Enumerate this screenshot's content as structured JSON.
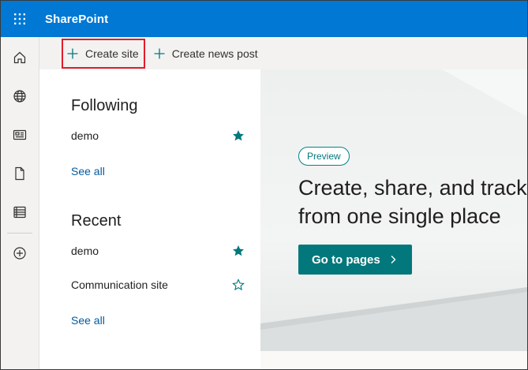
{
  "app": {
    "title": "SharePoint"
  },
  "colors": {
    "suite_bar": "#0078d4",
    "accent": "#03787c",
    "highlight_box": "#e11d2a"
  },
  "left_rail": {
    "icons": [
      "home-icon",
      "globe-icon",
      "news-icon",
      "document-icon",
      "list-icon",
      "add-circle-icon"
    ]
  },
  "command_bar": {
    "create_site": "Create site",
    "create_news_post": "Create news post"
  },
  "following": {
    "title": "Following",
    "items": [
      {
        "label": "demo",
        "starred": true
      }
    ],
    "see_all": "See all"
  },
  "recent": {
    "title": "Recent",
    "items": [
      {
        "label": "demo",
        "starred": true
      },
      {
        "label": "Communication site",
        "starred": false
      }
    ],
    "see_all": "See all"
  },
  "hero": {
    "badge": "Preview",
    "title_line1": "Create, share, and track",
    "title_line2": "from one single place",
    "button": "Go to pages"
  }
}
